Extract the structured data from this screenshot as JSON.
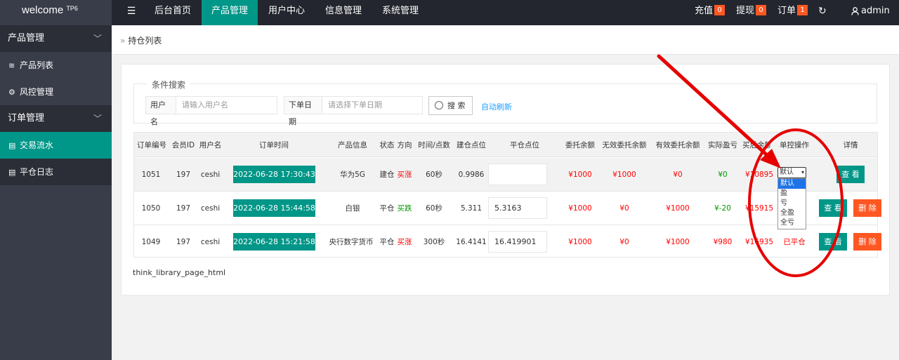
{
  "app": {
    "logo_text": "welcome",
    "logo_sup": "TP6"
  },
  "topnav": {
    "items": [
      "后台首页",
      "产品管理",
      "用户中心",
      "信息管理",
      "系统管理"
    ],
    "recharge": {
      "label": "充值",
      "count": "0"
    },
    "withdraw": {
      "label": "提现",
      "count": "0"
    },
    "orders": {
      "label": "订单",
      "count": "1"
    },
    "user": "admin"
  },
  "sidebar": {
    "group1": "产品管理",
    "item_products": "产品列表",
    "item_risk": "风控管理",
    "group2": "订单管理",
    "item_trades": "交易流水",
    "item_close_log": "平仓日志"
  },
  "breadcrumb": {
    "sep": "»",
    "current": "持仓列表"
  },
  "search": {
    "legend": "条件搜索",
    "username_label": "用户名",
    "username_placeholder": "请输入用户名",
    "date_label": "下单日期",
    "date_placeholder": "请选择下单日期",
    "search_button": "搜 索",
    "auto_refresh": "自动刷新"
  },
  "table": {
    "headers": [
      "订单编号",
      "会员ID",
      "用户名",
      "订单时间",
      "产品信息",
      "状态",
      "方向",
      "时间/点数",
      "建仓点位",
      "平仓点位",
      "委托余额",
      "无效委托余额",
      "有效委托余额",
      "实际盈亏",
      "买后余额",
      "单控操作",
      "详情"
    ],
    "rows": [
      {
        "id": "1051",
        "member": "197",
        "user": "ceshi",
        "time": "2022-06-28 17:30:43",
        "product": "华为5G",
        "status": "建仓",
        "direction": "买涨",
        "period": "60秒",
        "open": "0.9986",
        "close": "",
        "entrust": "¥1000",
        "invalid": "¥1000",
        "valid": "¥0",
        "pnl": "¥0",
        "balance": "¥10895",
        "op": "select",
        "view": "查 看"
      },
      {
        "id": "1050",
        "member": "197",
        "user": "ceshi",
        "time": "2022-06-28 15:44:58",
        "product": "白银",
        "status": "平仓",
        "direction": "买跌",
        "period": "60秒",
        "open": "5.311",
        "close": "5.3163",
        "entrust": "¥1000",
        "invalid": "¥0",
        "valid": "¥1000",
        "pnl": "¥-20",
        "balance": "¥15915",
        "op": "",
        "view": "查 看",
        "del": "删 除"
      },
      {
        "id": "1049",
        "member": "197",
        "user": "ceshi",
        "time": "2022-06-28 15:21:58",
        "product": "央行数字货币",
        "status": "平仓",
        "direction": "买涨",
        "period": "300秒",
        "open": "16.4141",
        "close": "16.419901",
        "entrust": "¥1000",
        "invalid": "¥0",
        "valid": "¥1000",
        "pnl": "¥980",
        "balance": "¥16935",
        "op": "已平仓",
        "view": "查 看",
        "del": "删 除"
      }
    ]
  },
  "select": {
    "current": "默认",
    "options": [
      "默认",
      "盈",
      "亏",
      "全盈",
      "全亏"
    ]
  },
  "pager": "think_library_page_html",
  "colors": {
    "dark": "#23262e",
    "side": "#393d49",
    "teal": "#009688",
    "orange": "#ff5722",
    "annotation": "#e60000"
  }
}
